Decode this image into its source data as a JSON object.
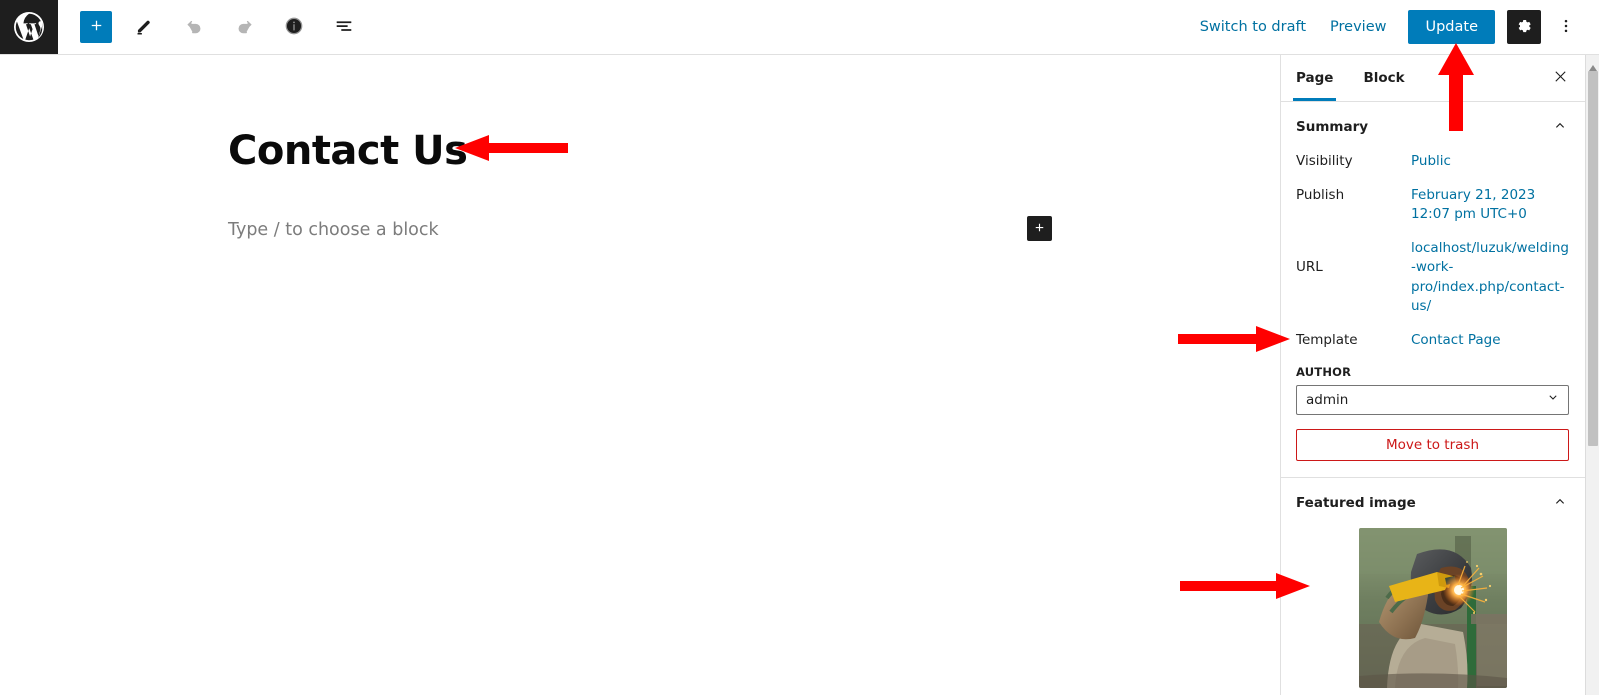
{
  "app": {
    "name": "WordPress Block Editor",
    "accent_color": "#007cba",
    "dark_color": "#1e1e1e",
    "link_color": "#0071a1",
    "danger_color": "#cc1818",
    "annotation_color": "#ff0000"
  },
  "header": {
    "logo_label": "WordPress",
    "left_tools": [
      {
        "name": "block-inserter-toggle",
        "label": "Toggle block inserter",
        "icon": "plus-icon",
        "state": "primary"
      },
      {
        "name": "tools-pencil",
        "label": "Tools",
        "icon": "pencil-icon",
        "state": "normal"
      },
      {
        "name": "undo",
        "label": "Undo",
        "icon": "undo-icon",
        "state": "disabled"
      },
      {
        "name": "redo",
        "label": "Redo",
        "icon": "redo-icon",
        "state": "disabled"
      },
      {
        "name": "details",
        "label": "Details",
        "icon": "info-icon",
        "state": "normal"
      },
      {
        "name": "list-view",
        "label": "List View",
        "icon": "list-view-icon",
        "state": "normal"
      }
    ],
    "switch_to_draft_label": "Switch to draft",
    "preview_label": "Preview",
    "update_label": "Update",
    "settings_label": "Settings",
    "settings_icon": "gear-icon",
    "options_label": "Options",
    "options_icon": "three-dots-vertical-icon"
  },
  "editor": {
    "post_title": "Contact Us",
    "block_placeholder": "Type / to choose a block",
    "inserter_icon": "plus-icon",
    "inserter_label": "Add block"
  },
  "sidebar": {
    "tabs": [
      {
        "label": "Page",
        "active": true
      },
      {
        "label": "Block",
        "active": false
      }
    ],
    "close_label": "Close settings",
    "close_icon": "close-icon",
    "summary": {
      "title": "Summary",
      "collapse_icon": "chevron-up-icon",
      "rows": [
        {
          "label": "Visibility",
          "value": "Public"
        },
        {
          "label": "Publish",
          "value": "February 21, 2023 12:07 pm UTC+0"
        },
        {
          "label": "URL",
          "value": "localhost/luzuk/welding-work-pro/index.php/contact-us/"
        },
        {
          "label": "Template",
          "value": "Contact Page"
        }
      ],
      "author_label": "AUTHOR",
      "author_value": "admin",
      "author_dropdown_icon": "chevron-down-icon",
      "trash_label": "Move to trash"
    },
    "featured_image": {
      "title": "Featured image",
      "collapse_icon": "chevron-up-icon",
      "alt": "Welder wearing mask using a welding torch on a metal fence"
    }
  },
  "scrollbar": {
    "name": "sidebar-scrollbar",
    "arrow_icon": "triangle-up-icon"
  },
  "annotations": [
    {
      "name": "annotation-arrow-title",
      "direction": "left",
      "target": "post-title"
    },
    {
      "name": "annotation-arrow-update",
      "direction": "up",
      "target": "update-button"
    },
    {
      "name": "annotation-arrow-template",
      "direction": "right",
      "target": "template-row"
    },
    {
      "name": "annotation-arrow-featured-image",
      "direction": "right",
      "target": "featured-image-panel"
    }
  ]
}
